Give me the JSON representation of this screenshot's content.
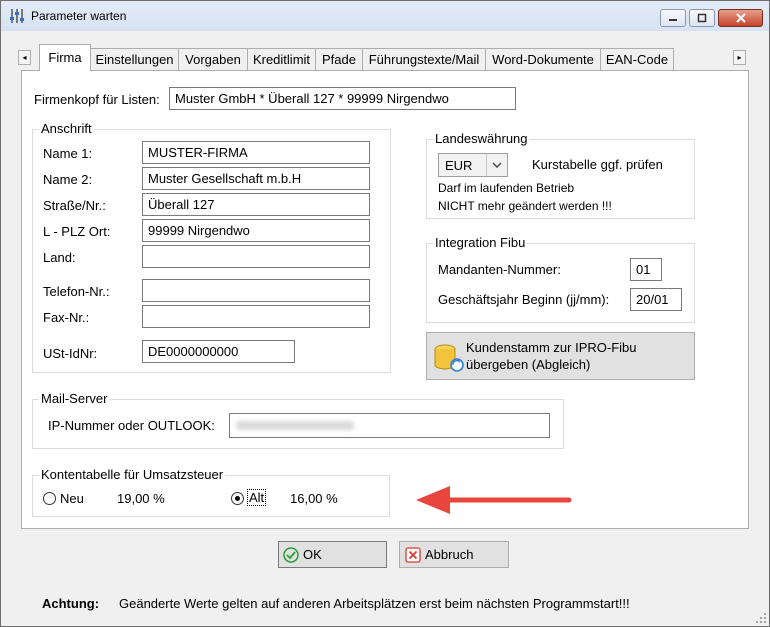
{
  "window": {
    "title": "Parameter warten"
  },
  "tabs": [
    {
      "label": "Firma",
      "active": true
    },
    {
      "label": "Einstellungen"
    },
    {
      "label": "Vorgaben"
    },
    {
      "label": "Kreditlimit"
    },
    {
      "label": "Pfade"
    },
    {
      "label": "Führungstexte/Mail"
    },
    {
      "label": "Word-Dokumente"
    },
    {
      "label": "EAN-Code"
    }
  ],
  "firmenkopf": {
    "label": "Firmenkopf für Listen:",
    "value": "Muster GmbH * Überall 127 * 99999 Nirgendwo"
  },
  "anschrift": {
    "title": "Anschrift",
    "name1": {
      "label": "Name 1:",
      "value": "MUSTER-FIRMA"
    },
    "name2": {
      "label": "Name 2:",
      "value": "Muster Gesellschaft m.b.H"
    },
    "strasse": {
      "label": "Straße/Nr.:",
      "value": "Überall 127"
    },
    "plz": {
      "label": "L - PLZ Ort:",
      "value": "99999 Nirgendwo"
    },
    "land": {
      "label": "Land:",
      "value": ""
    },
    "telefon": {
      "label": "Telefon-Nr.:",
      "value": ""
    },
    "fax": {
      "label": "Fax-Nr.:",
      "value": ""
    },
    "ustid": {
      "label": "USt-IdNr:",
      "value": "DE0000000000"
    }
  },
  "landeswaehrung": {
    "title": "Landeswährung",
    "currency": "EUR",
    "hint": "Kurstabelle ggf. prüfen",
    "note_line1": "Darf im laufenden Betrieb",
    "note_line2": "NICHT mehr geändert werden !!!"
  },
  "fibu": {
    "title": "Integration Fibu",
    "mandant": {
      "label": "Mandanten-Nummer:",
      "value": "01"
    },
    "gj": {
      "label": "Geschäftsjahr Beginn (jj/mm):",
      "value": "20/01"
    },
    "export_line1": "Kundenstamm zur IPRO-Fibu",
    "export_line2": "übergeben (Abgleich)"
  },
  "mailserver": {
    "title": "Mail-Server",
    "label": "IP-Nummer oder OUTLOOK:"
  },
  "konten": {
    "title": "Kontentabelle für Umsatzsteuer",
    "neu_label": "Neu",
    "neu_rate": "19,00 %",
    "alt_label": "Alt",
    "alt_rate": "16,00 %",
    "selected": "Alt"
  },
  "buttons": {
    "ok": "OK",
    "cancel": "Abbruch"
  },
  "footer": {
    "label": "Achtung:",
    "text": "Geänderte Werte gelten auf anderen Arbeitsplätzen erst beim nächsten Programmstart!!!"
  },
  "colors": {
    "annotation_arrow": "#e8453c",
    "ok_check": "#2e9d3a",
    "cancel_x": "#d83a2e"
  }
}
